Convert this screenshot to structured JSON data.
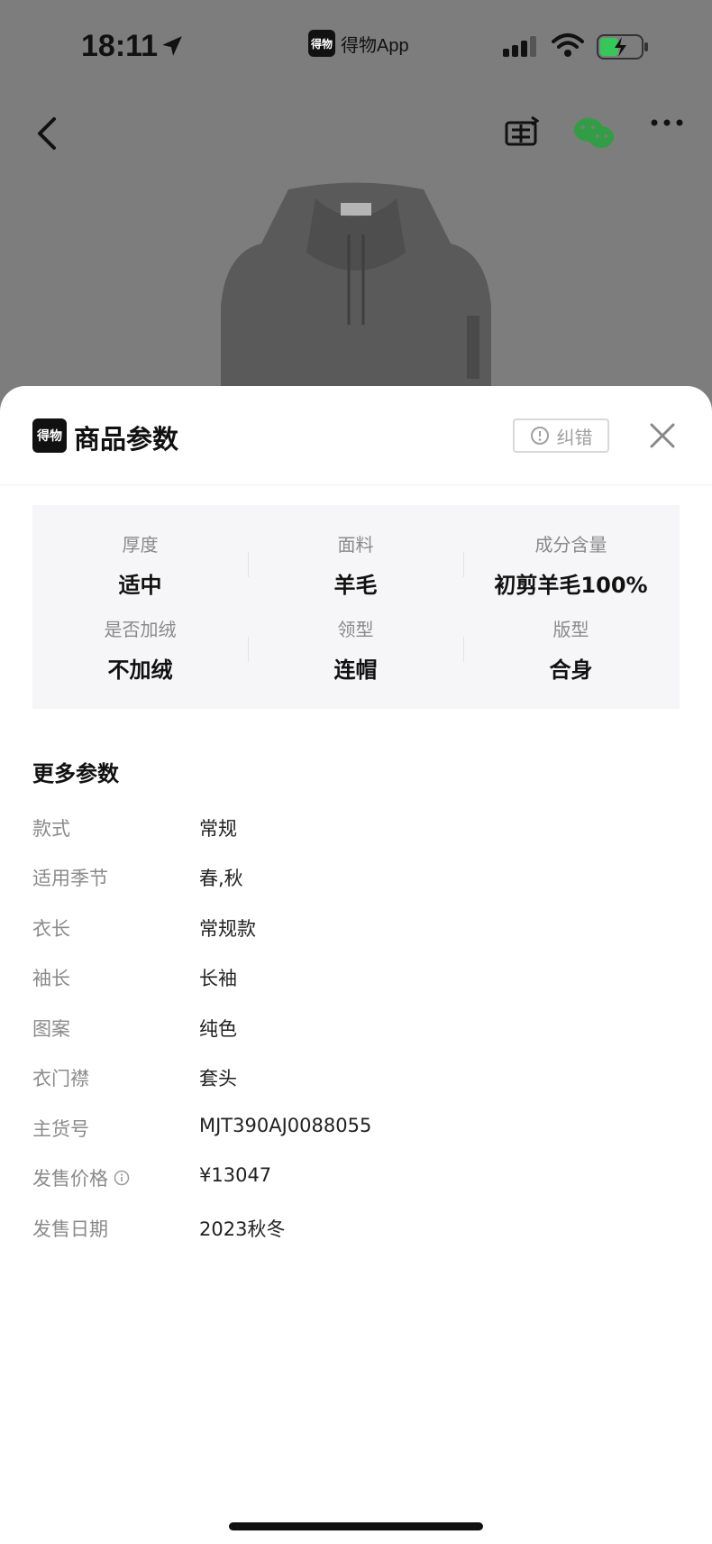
{
  "status_bar": {
    "time": "18:11",
    "app_logo_text": "得物",
    "app_name": "得物App"
  },
  "top_nav": {
    "icons": [
      "back-icon",
      "sell-icon",
      "wechat-icon",
      "more-icon"
    ]
  },
  "sheet": {
    "logo_text": "得物",
    "title": "商品参数",
    "report_label": "纠错",
    "summary": [
      {
        "label": "厚度",
        "value": "适中"
      },
      {
        "label": "面料",
        "value": "羊毛"
      },
      {
        "label": "成分含量",
        "value": "初剪羊毛100%"
      },
      {
        "label": "是否加绒",
        "value": "不加绒"
      },
      {
        "label": "领型",
        "value": "连帽"
      },
      {
        "label": "版型",
        "value": "合身"
      }
    ],
    "more_title": "更多参数",
    "params": [
      {
        "key": "款式",
        "value": "常规"
      },
      {
        "key": "适用季节",
        "value": "春,秋"
      },
      {
        "key": "衣长",
        "value": "常规款"
      },
      {
        "key": "袖长",
        "value": "长袖"
      },
      {
        "key": "图案",
        "value": "纯色"
      },
      {
        "key": "衣门襟",
        "value": "套头"
      },
      {
        "key": "主货号",
        "value": "MJT390AJ0088055"
      },
      {
        "key": "发售价格",
        "value": "¥13047"
      },
      {
        "key": "发售日期",
        "value": "2023秋冬"
      }
    ]
  },
  "colors": {
    "overlay_bg": "#7d7d7d",
    "summary_bg": "#f6f6f8",
    "muted_text": "#8a8a8a"
  }
}
